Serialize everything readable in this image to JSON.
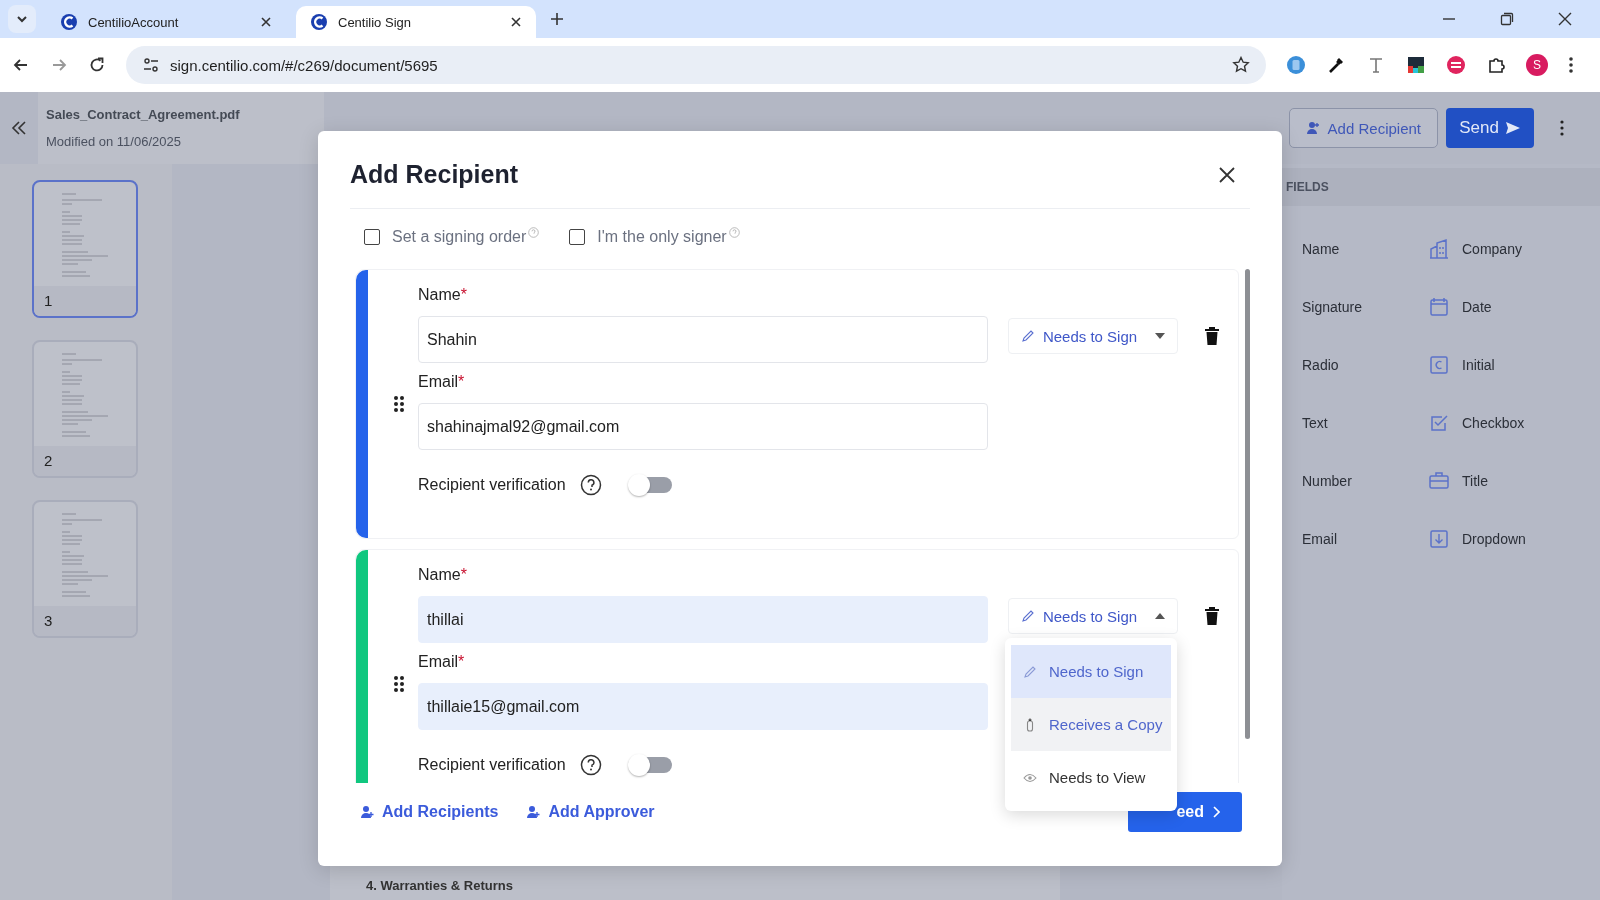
{
  "browser": {
    "tabs": [
      {
        "title": "CentilioAccount",
        "selected": false
      },
      {
        "title": "Centilio Sign",
        "selected": true
      }
    ],
    "url": "sign.centilio.com/#/c269/document/5695",
    "profile_initial": "S"
  },
  "document": {
    "file_name": "Sales_Contract_Agreement.pdf",
    "modified": "Modified on 11/06/2025",
    "pages": [
      {
        "number": "1",
        "selected": true
      },
      {
        "number": "2",
        "selected": false
      },
      {
        "number": "3",
        "selected": false
      }
    ],
    "section_heading": "4. Warranties & Returns"
  },
  "toolbar": {
    "add_recipient": "Add Recipient",
    "send": "Send"
  },
  "fields_panel": {
    "heading": "FIELDS",
    "items": [
      {
        "label": "Name"
      },
      {
        "label": "Company",
        "kind": "company"
      },
      {
        "label": "Signature"
      },
      {
        "label": "Date",
        "kind": "date"
      },
      {
        "label": "Radio"
      },
      {
        "label": "Initial",
        "kind": "initial"
      },
      {
        "label": "Text"
      },
      {
        "label": "Checkbox",
        "kind": "checkbox"
      },
      {
        "label": "Number"
      },
      {
        "label": "Title",
        "kind": "title"
      },
      {
        "label": "Email"
      },
      {
        "label": "Dropdown",
        "kind": "dropdown"
      }
    ]
  },
  "dialog": {
    "title": "Add Recipient",
    "options": [
      {
        "label": "Set a signing order",
        "checked": false
      },
      {
        "label": "I'm the only signer",
        "checked": false
      }
    ],
    "recipients": [
      {
        "color": "#2563eb",
        "name_field": {
          "label": "Name",
          "required_mark": "*",
          "value": "Shahin"
        },
        "email_field": {
          "label": "Email",
          "required_mark": "*",
          "value": "shahinajmal92@gmail.com"
        },
        "autofilled": false,
        "role": "Needs to Sign",
        "expanded": false,
        "verification_label": "Recipient verification",
        "verification_on": false
      },
      {
        "color": "#10c77f",
        "name_field": {
          "label": "Name",
          "required_mark": "*",
          "value": "thillai"
        },
        "email_field": {
          "label": "Email",
          "required_mark": "*",
          "value": "thillaie15@gmail.com"
        },
        "autofilled": true,
        "role": "Needs to Sign",
        "expanded": true,
        "verification_label": "Recipient verification",
        "verification_on": false
      }
    ],
    "role_menu": [
      {
        "label": "Needs to Sign",
        "kind": "sign",
        "selected": true,
        "hovered": false
      },
      {
        "label": "Receives a Copy",
        "kind": "copy",
        "selected": false,
        "hovered": true
      },
      {
        "label": "Needs to View",
        "kind": "view",
        "selected": false,
        "hovered": false
      }
    ],
    "add_recipients": "Add Recipients",
    "add_approver": "Add Approver",
    "proceed": "eed"
  }
}
